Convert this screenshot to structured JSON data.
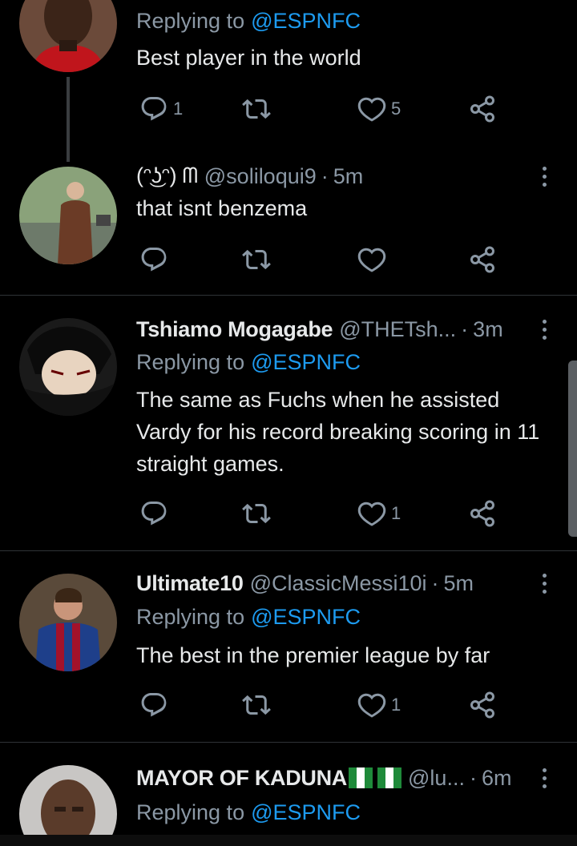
{
  "tweets": [
    {
      "name": "",
      "handle": "",
      "time": "",
      "replying_label": "Replying to",
      "replying_to": "@ESPNFC",
      "text": "Best player in the world",
      "reply_count": "1",
      "retweet_count": "",
      "like_count": "5",
      "avatar_icon": "avatar-photo-red-kit"
    },
    {
      "name": "(ᵔ͜ʖᵔ) ᗰ",
      "handle": "@soliloqui9",
      "time": "5m",
      "text": "that isnt benzema",
      "reply_count": "",
      "retweet_count": "",
      "like_count": "",
      "avatar_icon": "avatar-photo-suit"
    },
    {
      "name": "Tshiamo Mogagabe",
      "handle": "@THETsh...",
      "time": "3m",
      "replying_label": "Replying to",
      "replying_to": "@ESPNFC",
      "text": "The same as Fuchs when he assisted Vardy for his record breaking scoring in 11 straight games.",
      "reply_count": "",
      "retweet_count": "",
      "like_count": "1",
      "avatar_icon": "avatar-anime"
    },
    {
      "name": "Ultimate10",
      "handle": "@ClassicMessi10i",
      "time": "5m",
      "replying_label": "Replying to",
      "replying_to": "@ESPNFC",
      "text": "The best in the premier league by far",
      "reply_count": "",
      "retweet_count": "",
      "like_count": "1",
      "avatar_icon": "avatar-photo-barca"
    },
    {
      "name": "MAYOR OF KADUNA",
      "handle": "@lu...",
      "time": "6m",
      "replying_label": "Replying to",
      "replying_to": "@ESPNFC",
      "flag_icon": "nigeria-flag-icon",
      "avatar_icon": "avatar-photo-man"
    }
  ],
  "time_separator": "·",
  "colors": {
    "background": "#000000",
    "text": "#e7e9ea",
    "muted": "#8b98a5",
    "link": "#1d9bf0",
    "divider": "#2f3336"
  }
}
